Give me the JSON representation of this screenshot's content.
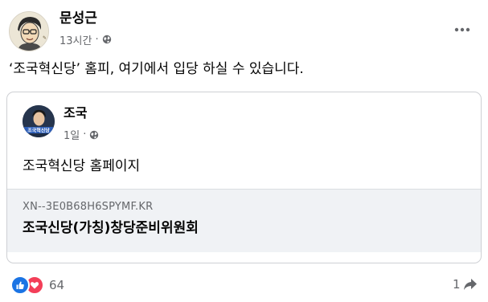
{
  "post": {
    "author": "문성근",
    "time": "13시간",
    "privacy_icon": "globe-icon",
    "more_icon": "more-options-icon",
    "text": "‘조국혁신당’ 홈피, 여기에서 입당 하실 수 있습니다."
  },
  "shared_post": {
    "author": "조국",
    "time": "1일",
    "privacy_icon": "globe-icon",
    "avatar_caption": "조국혁신당",
    "text": "조국혁신당 홈페이지",
    "link": {
      "domain": "XN--3E0B68H6SPYMF.KR",
      "title": "조국신당(가칭)창당준비위원회"
    }
  },
  "footer": {
    "reaction_icons": [
      "like-reaction-icon",
      "love-reaction-icon"
    ],
    "reaction_count": "64",
    "share_count": "1",
    "share_icon": "share-icon"
  },
  "colors": {
    "text_primary": "#050505",
    "text_secondary": "#65676b",
    "card_border": "#ced0d4",
    "link_bg": "#f0f2f5",
    "like_blue": "#1b74e4",
    "love_red": "#f33e58"
  }
}
